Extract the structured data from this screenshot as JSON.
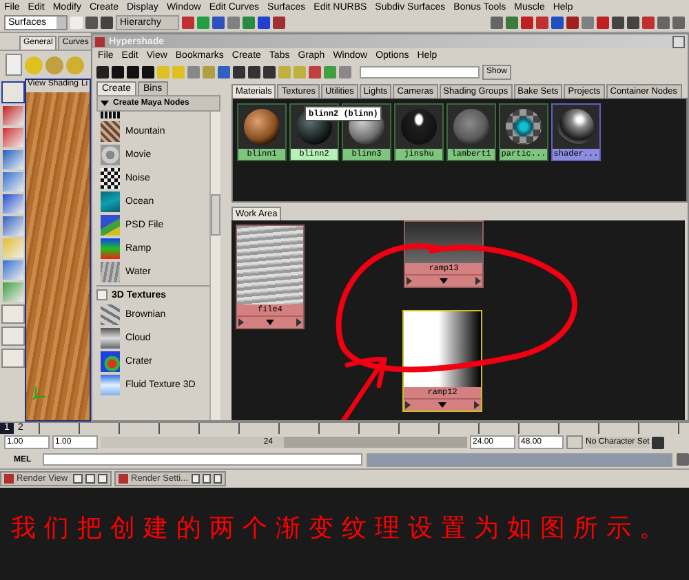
{
  "menu_bar": [
    "File",
    "Edit",
    "Modify",
    "Create",
    "Display",
    "Window",
    "Edit Curves",
    "Surfaces",
    "Edit NURBS",
    "Subdiv Surfaces",
    "Bonus Tools",
    "Muscle",
    "Help"
  ],
  "status_line": {
    "menu_set": "Surfaces",
    "selection_mode": "Hierarchy"
  },
  "shelf_tabs": [
    {
      "label": "General",
      "selected": true
    },
    {
      "label": "Curves",
      "selected": false
    }
  ],
  "viewport": {
    "menus": [
      "View",
      "Shading",
      "Li"
    ]
  },
  "hypershade": {
    "title": "Hypershade",
    "menus": [
      "File",
      "Edit",
      "View",
      "Bookmarks",
      "Create",
      "Tabs",
      "Graph",
      "Window",
      "Options",
      "Help"
    ],
    "show_button": "Show",
    "create_tabs": [
      {
        "label": "Create",
        "selected": true
      },
      {
        "label": "Bins",
        "selected": false
      }
    ],
    "create_header": "Create Maya Nodes",
    "nodes": [
      {
        "name": "Mountain",
        "kind": "mountain"
      },
      {
        "name": "Movie",
        "kind": "movie"
      },
      {
        "name": "Noise",
        "kind": "noise"
      },
      {
        "name": "Ocean",
        "kind": "ocean"
      },
      {
        "name": "PSD File",
        "kind": "psd"
      },
      {
        "name": "Ramp",
        "kind": "ramp"
      },
      {
        "name": "Water",
        "kind": "water"
      }
    ],
    "section": "3D Textures",
    "nodes_3d": [
      {
        "name": "Brownian",
        "kind": "brownian"
      },
      {
        "name": "Cloud",
        "kind": "cloud"
      },
      {
        "name": "Crater",
        "kind": "crater"
      },
      {
        "name": "Fluid Texture 3D",
        "kind": "fluid"
      }
    ],
    "bin_tabs": [
      {
        "label": "Materials",
        "selected": true
      },
      {
        "label": "Textures",
        "selected": false
      },
      {
        "label": "Utilities",
        "selected": false
      },
      {
        "label": "Lights",
        "selected": false
      },
      {
        "label": "Cameras",
        "selected": false
      },
      {
        "label": "Shading Groups",
        "selected": false
      },
      {
        "label": "Bake Sets",
        "selected": false
      },
      {
        "label": "Projects",
        "selected": false
      },
      {
        "label": "Container Nodes",
        "selected": false
      }
    ],
    "swatches": [
      {
        "name": "blinn1",
        "kind": "wood",
        "hovered": false,
        "selected": false
      },
      {
        "name": "blinn2",
        "kind": "black",
        "hovered": true,
        "selected": false
      },
      {
        "name": "blinn3",
        "kind": "grey",
        "hovered": false,
        "selected": false
      },
      {
        "name": "jinshu",
        "kind": "metal",
        "hovered": false,
        "selected": false
      },
      {
        "name": "lambert1",
        "kind": "matte",
        "hovered": false,
        "selected": false
      },
      {
        "name": "partic...",
        "kind": "particle",
        "hovered": false,
        "selected": false
      },
      {
        "name": "shader...",
        "kind": "shiny",
        "hovered": false,
        "selected": true
      }
    ],
    "tooltip": "blinn2 (blinn)",
    "work_area_tab": "Work Area",
    "graph_nodes": [
      {
        "name": "file4",
        "kind": "file",
        "selected": false
      },
      {
        "name": "ramp13",
        "kind": "ramp_dark",
        "selected": false
      },
      {
        "name": "ramp12",
        "kind": "ramp_light",
        "selected": true
      }
    ]
  },
  "time_slider": {
    "current_frame": "1",
    "tick_label": "2",
    "level": 0
  },
  "range": {
    "start": "1.00",
    "playback_start": "1.00",
    "playback_end": "24",
    "end": "24.00",
    "range_end": "48.00",
    "character_set": "No Character Set",
    "level": 0.5
  },
  "command_line": {
    "label": "MEL"
  },
  "taskbar": [
    {
      "label": "Render View"
    },
    {
      "label": "Render Setti..."
    }
  ],
  "caption": "我们把创建的两个渐变纹理设置为如图所示。"
}
